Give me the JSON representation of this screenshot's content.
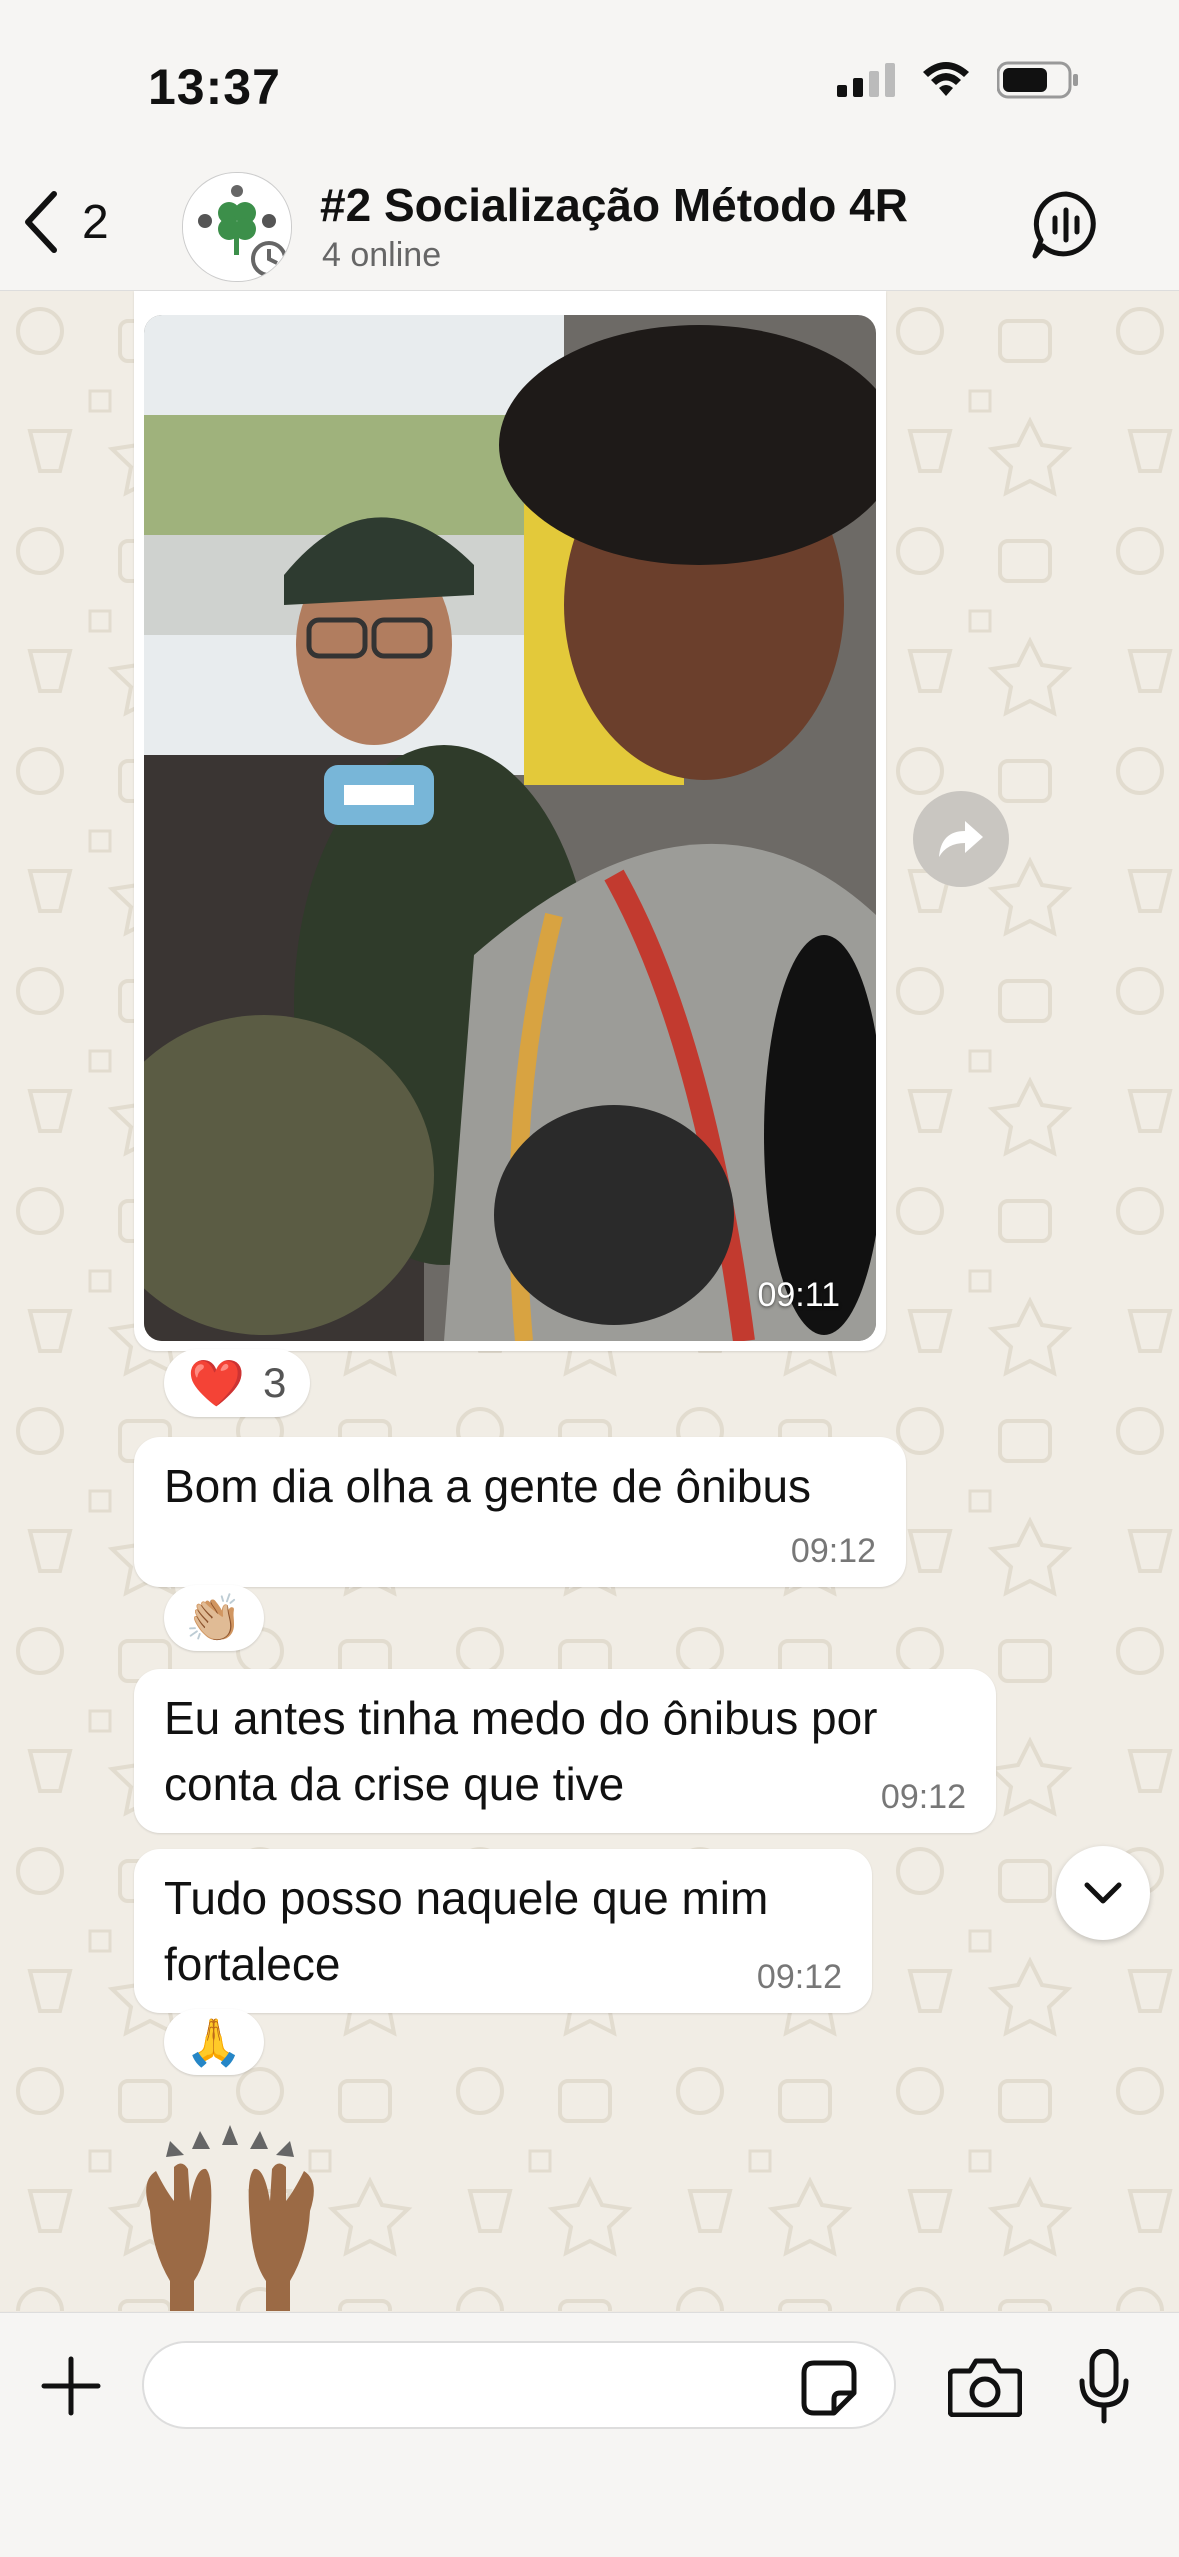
{
  "status_bar": {
    "time": "13:37"
  },
  "header": {
    "back_count": "2",
    "title": "#2 Socialização Método 4R",
    "subtitle": "4 online"
  },
  "messages": [
    {
      "type": "image",
      "time": "09:11",
      "reaction": {
        "emoji": "❤️",
        "count": "3"
      }
    },
    {
      "type": "text",
      "text": "Bom dia olha a gente de ônibus",
      "time": "09:12",
      "reaction": {
        "emoji": "👏🏼"
      }
    },
    {
      "type": "text",
      "text": "Eu antes tinha medo do ônibus por conta da crise que tive",
      "time": "09:12"
    },
    {
      "type": "text",
      "text": "Tudo posso naquele que mim fortalece",
      "time": "09:12",
      "reaction": {
        "emoji": "🙏"
      }
    },
    {
      "type": "emoji",
      "emoji": "🙌🏽"
    }
  ],
  "composer": {
    "placeholder": ""
  },
  "icons": {
    "back": "chevron-left-icon",
    "call": "group-call-icon",
    "forward": "forward-icon",
    "scroll_down": "chevron-down-icon",
    "attach": "plus-icon",
    "sticker": "sticker-icon",
    "camera": "camera-icon",
    "mic": "mic-icon"
  },
  "colors": {
    "chat_bg": "#f1ede5",
    "bar_bg": "#f6f5f3",
    "bubble": "#ffffff"
  }
}
